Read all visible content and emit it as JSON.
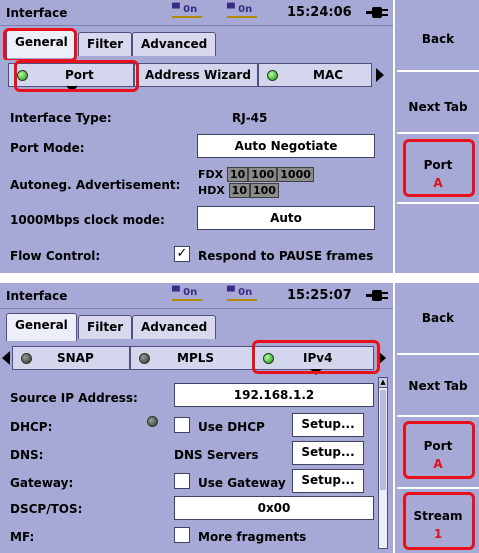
{
  "panel1": {
    "title": "Interface",
    "indicator1": "0n",
    "indicator2": "0n",
    "clock": "15:24:06",
    "tabs": [
      "General",
      "Filter",
      "Advanced"
    ],
    "subtabs": [
      "Port",
      "Address Wizard",
      "MAC"
    ],
    "fields": {
      "interface_type_label": "Interface Type:",
      "interface_type_value": "RJ-45",
      "port_mode_label": "Port Mode:",
      "port_mode_value": "Auto Negotiate",
      "autoneg_label": "Autoneg. Advertisement:",
      "fdx_label": "FDX",
      "fdx_speeds": [
        "10",
        "100",
        "1000"
      ],
      "hdx_label": "HDX",
      "hdx_speeds": [
        "10",
        "100"
      ],
      "clock_mode_label": "1000Mbps clock mode:",
      "clock_mode_value": "Auto",
      "flow_control_label": "Flow Control:",
      "flow_control_check": "✓",
      "flow_control_option": "Respond to PAUSE frames"
    },
    "side": {
      "back": "Back",
      "next_tab": "Next Tab",
      "port_label": "Port",
      "port_value": "A"
    }
  },
  "panel2": {
    "title": "Interface",
    "indicator1": "0n",
    "indicator2": "0n",
    "clock": "15:25:07",
    "tabs": [
      "General",
      "Filter",
      "Advanced"
    ],
    "subtabs": [
      "SNAP",
      "MPLS",
      "IPv4"
    ],
    "fields": {
      "source_ip_label": "Source IP Address:",
      "source_ip_value": "192.168.1.2",
      "dhcp_label": "DHCP:",
      "dhcp_option": "Use DHCP",
      "dns_label": "DNS:",
      "dns_value": "DNS Servers",
      "gateway_label": "Gateway:",
      "gateway_option": "Use Gateway",
      "dscp_label": "DSCP/TOS:",
      "dscp_value": "0x00",
      "mf_label": "MF:",
      "mf_option": "More fragments",
      "setup": "Setup..."
    },
    "side": {
      "back": "Back",
      "next_tab": "Next Tab",
      "port_label": "Port",
      "port_value": "A",
      "stream_label": "Stream",
      "stream_value": "1"
    }
  },
  "colors": {
    "background": "#a6a9d6",
    "highlight": "#e8101a",
    "led_green": "#1f8a19",
    "value_red": "#e0101a"
  }
}
